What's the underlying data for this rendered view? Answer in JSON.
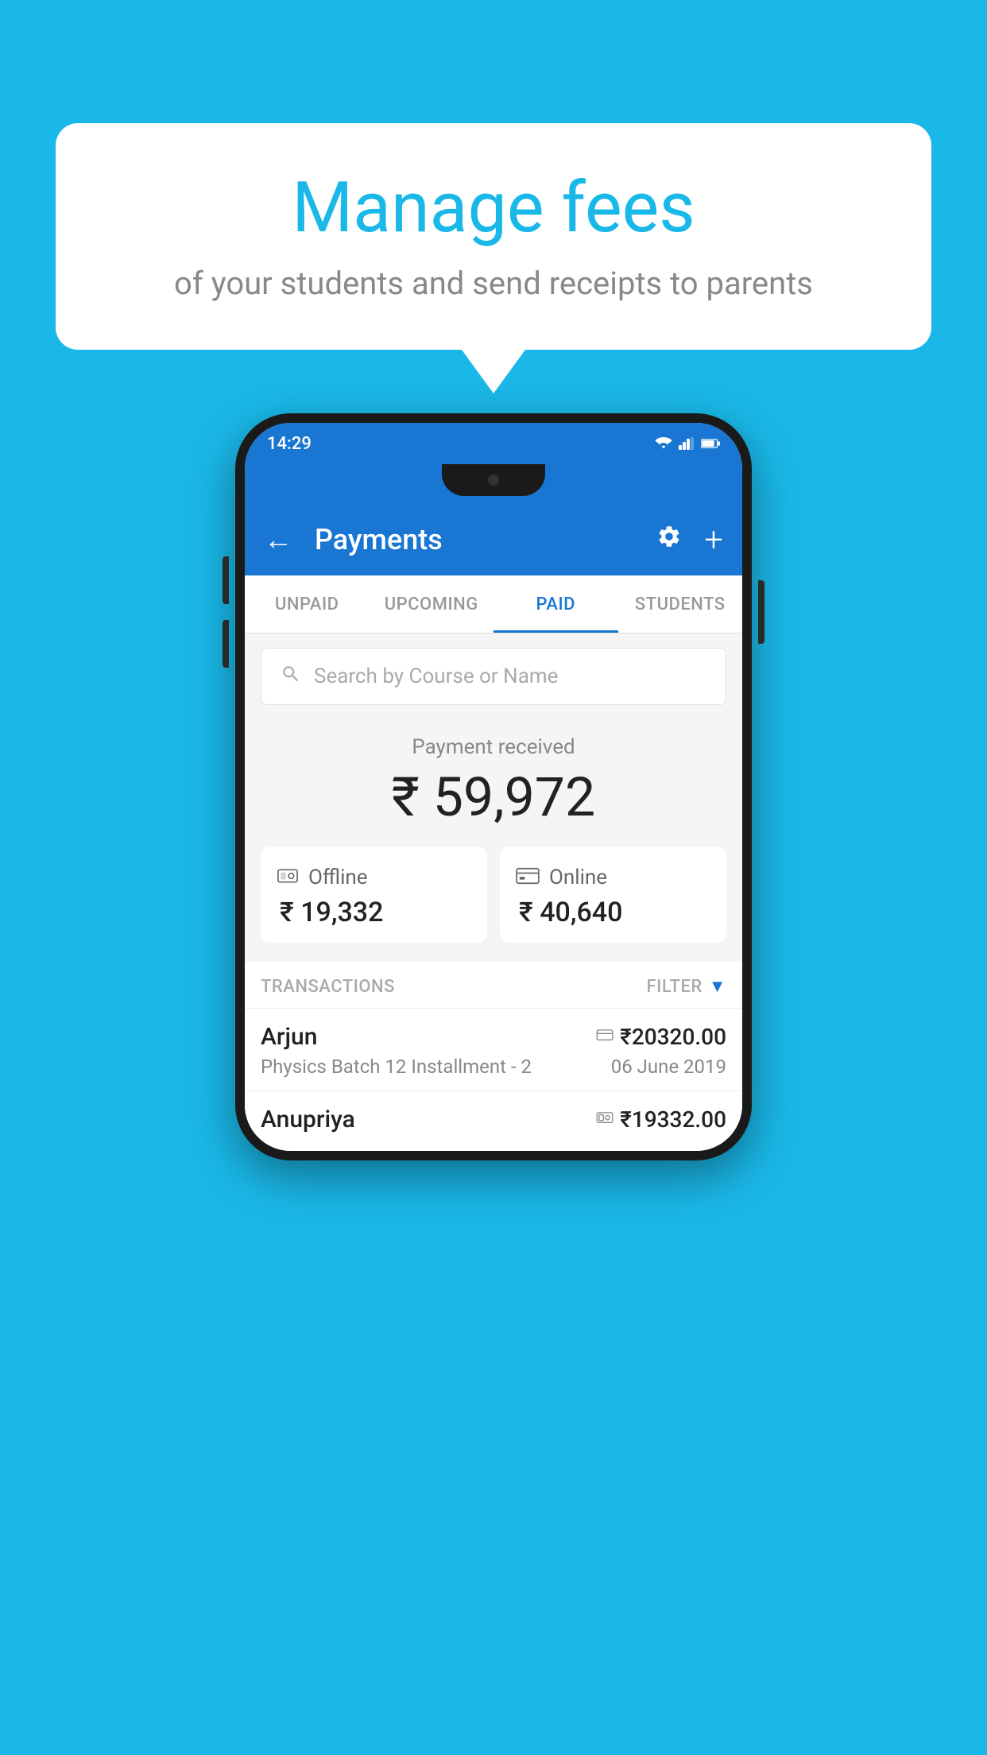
{
  "background_color": "#1ab8e8",
  "bubble": {
    "title": "Manage fees",
    "subtitle": "of your students and send receipts to parents"
  },
  "phone": {
    "status_bar": {
      "time": "14:29"
    },
    "app_bar": {
      "title": "Payments",
      "back_icon": "←",
      "settings_icon": "⚙",
      "add_icon": "+"
    },
    "tabs": [
      {
        "label": "UNPAID",
        "active": false
      },
      {
        "label": "UPCOMING",
        "active": false
      },
      {
        "label": "PAID",
        "active": true
      },
      {
        "label": "STUDENTS",
        "active": false
      }
    ],
    "search": {
      "placeholder": "Search by Course or Name"
    },
    "payment_summary": {
      "label": "Payment received",
      "amount": "₹ 59,972",
      "offline": {
        "label": "Offline",
        "amount": "₹ 19,332"
      },
      "online": {
        "label": "Online",
        "amount": "₹ 40,640"
      }
    },
    "transactions_section": {
      "label": "TRANSACTIONS",
      "filter_label": "FILTER"
    },
    "transactions": [
      {
        "name": "Arjun",
        "course": "Physics Batch 12 Installment - 2",
        "amount": "₹20320.00",
        "date": "06 June 2019",
        "type": "online"
      },
      {
        "name": "Anupriya",
        "course": "",
        "amount": "₹19332.00",
        "date": "",
        "type": "offline"
      }
    ]
  }
}
